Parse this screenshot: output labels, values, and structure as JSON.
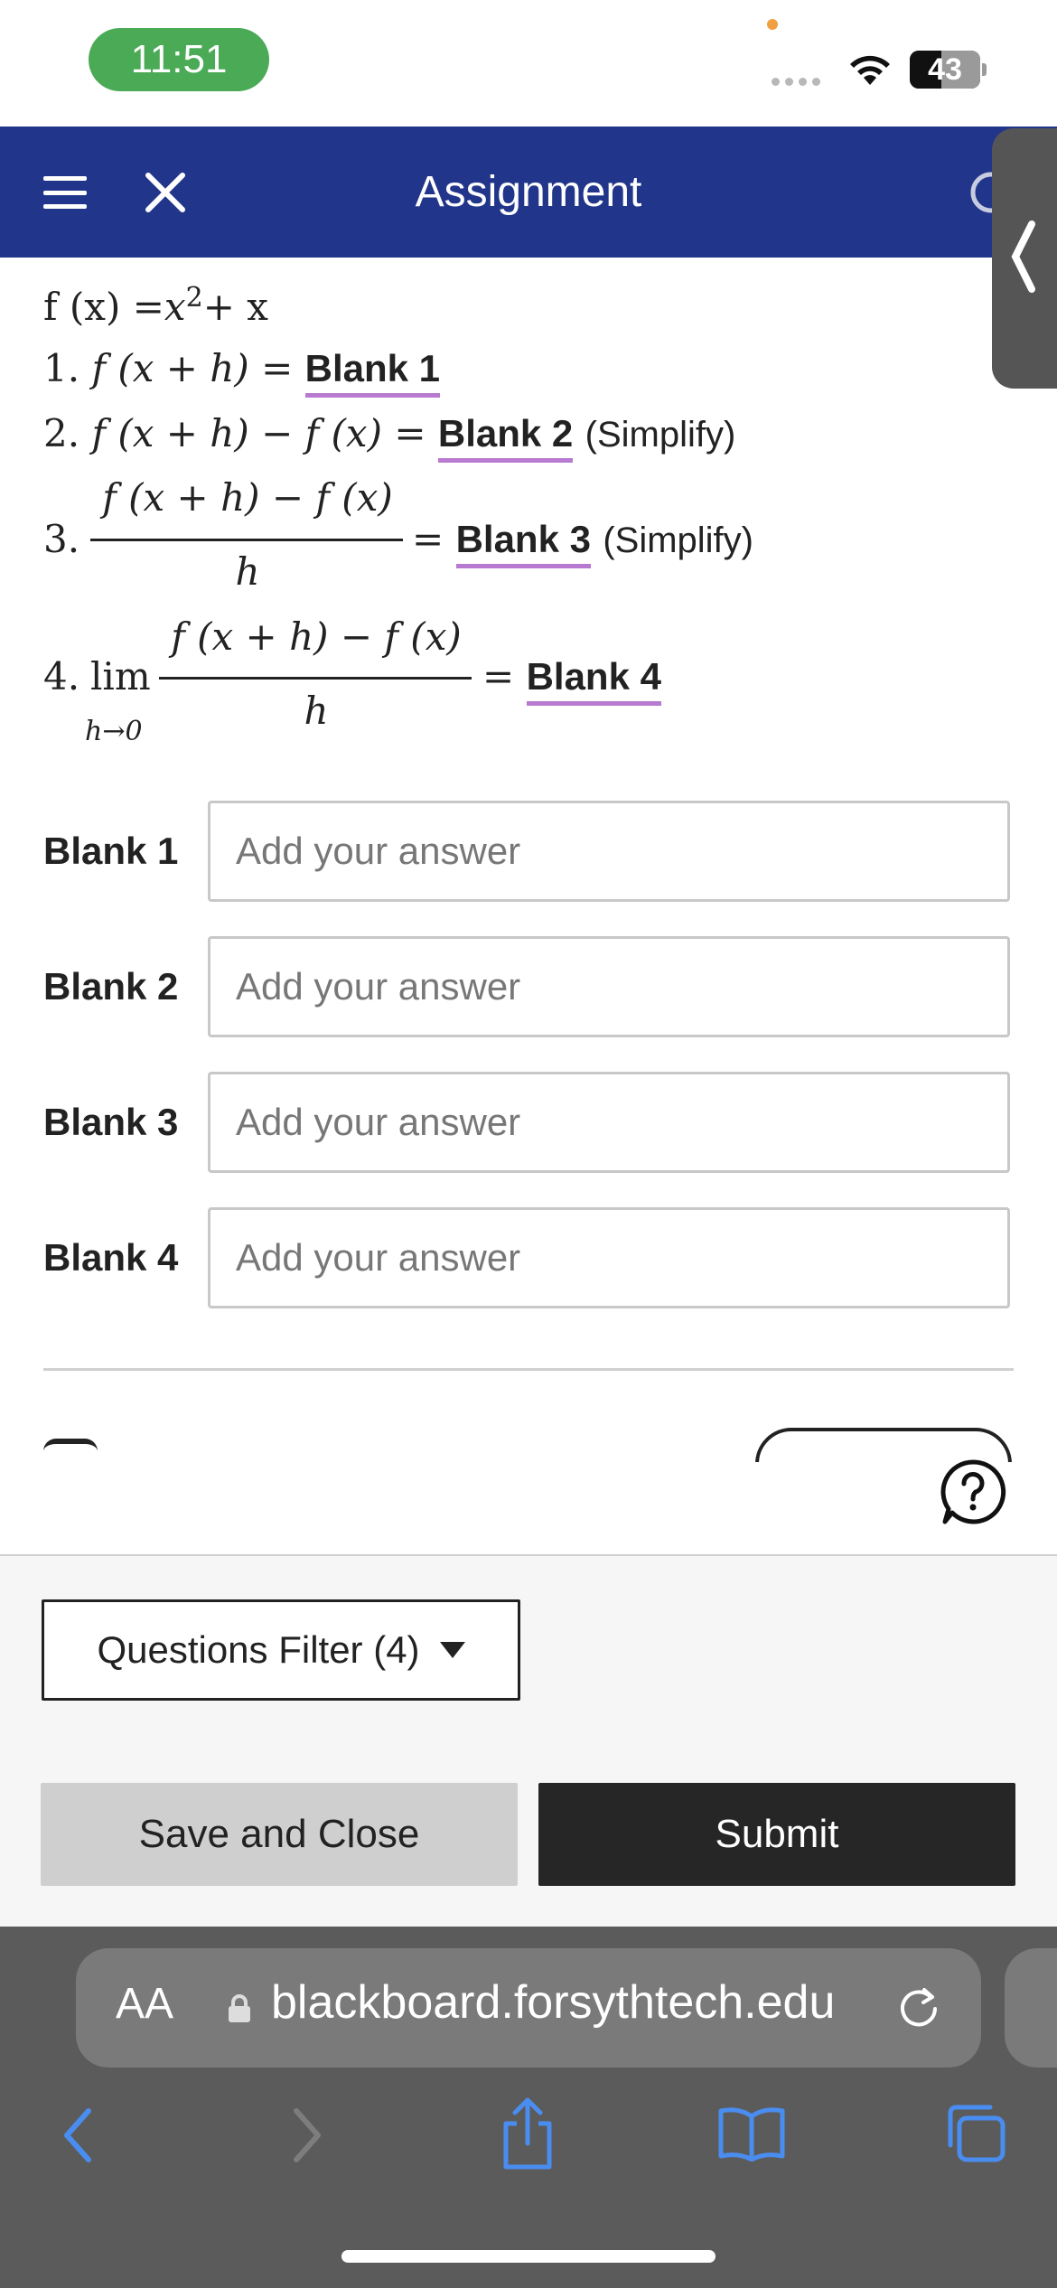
{
  "status_bar": {
    "time": "11:51",
    "battery": "43"
  },
  "header": {
    "title": "Assignment"
  },
  "question": {
    "function_def": {
      "lhs": "f (x) =",
      "base": "x",
      "exp": "2",
      "rest": "+ x"
    },
    "items": [
      {
        "num": "1.",
        "expr": "f (x + h) =",
        "blank": "Blank 1"
      },
      {
        "num": "2.",
        "expr": "f (x + h) − f (x) =",
        "blank": "Blank 2",
        "note": "(Simplify)"
      },
      {
        "num": "3.",
        "numerator": "f (x + h) − f (x)",
        "denominator": "h",
        "eq": "=",
        "blank": "Blank 3",
        "note": "(Simplify)"
      },
      {
        "num": "4.",
        "lim": "lim",
        "lim_sub": "h→0",
        "numerator": "f (x + h) − f (x)",
        "denominator": "h",
        "eq": "=",
        "blank": "Blank 4"
      }
    ]
  },
  "answers": [
    {
      "label": "Blank 1",
      "placeholder": "Add your answer",
      "value": ""
    },
    {
      "label": "Blank 2",
      "placeholder": "Add your answer",
      "value": ""
    },
    {
      "label": "Blank 3",
      "placeholder": "Add your answer",
      "value": ""
    },
    {
      "label": "Blank 4",
      "placeholder": "Add your answer",
      "value": ""
    }
  ],
  "footer": {
    "filter_label": "Questions Filter (4)",
    "save_label": "Save and Close",
    "submit_label": "Submit"
  },
  "browser": {
    "text_size": "AA",
    "url": "blackboard.forsythtech.edu"
  },
  "colors": {
    "header": "#21358a",
    "blank_underline": "#b87ad0",
    "submit": "#262626",
    "time_pill": "#4aaa55"
  }
}
